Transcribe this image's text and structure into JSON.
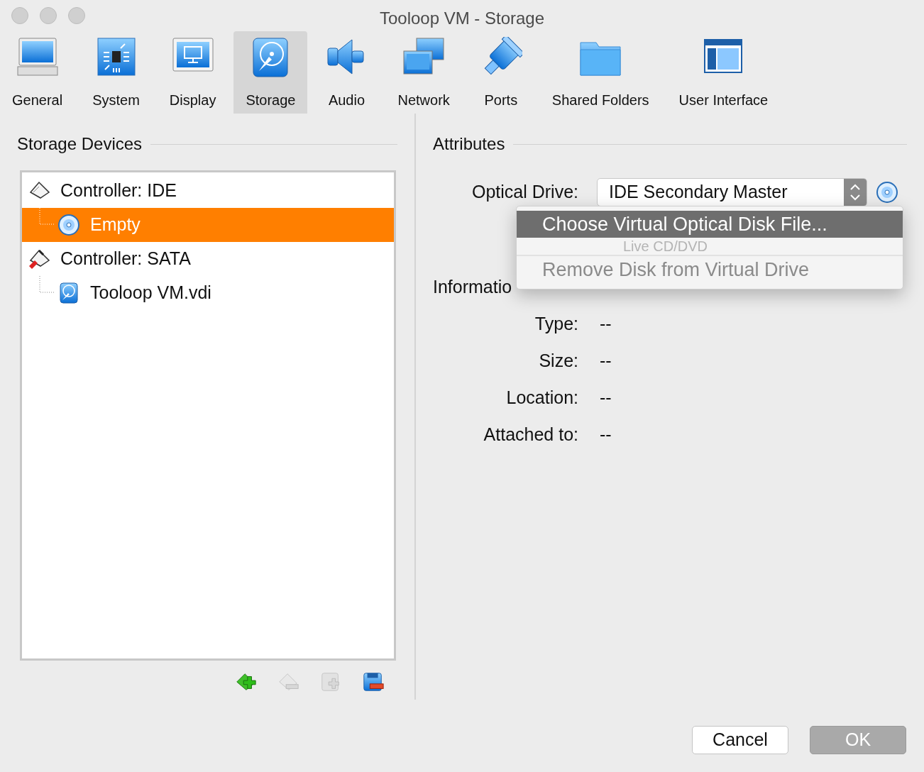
{
  "window": {
    "title": "Tooloop VM - Storage"
  },
  "toolbar": [
    {
      "label": "General",
      "kind": "monitor",
      "selected": false
    },
    {
      "label": "System",
      "kind": "chip",
      "selected": false
    },
    {
      "label": "Display",
      "kind": "display",
      "selected": false
    },
    {
      "label": "Storage",
      "kind": "disk",
      "selected": true
    },
    {
      "label": "Audio",
      "kind": "speaker",
      "selected": false
    },
    {
      "label": "Network",
      "kind": "network",
      "selected": false
    },
    {
      "label": "Ports",
      "kind": "plug",
      "selected": false
    },
    {
      "label": "Shared Folders",
      "kind": "folder",
      "selected": false
    },
    {
      "label": "User Interface",
      "kind": "window",
      "selected": false
    }
  ],
  "storage_devices": {
    "title": "Storage Devices",
    "tree": [
      {
        "label": "Controller: IDE",
        "kind": "ide",
        "selected": false,
        "children": [
          {
            "label": "Empty",
            "kind": "optical",
            "selected": true
          }
        ]
      },
      {
        "label": "Controller: SATA",
        "kind": "sata",
        "selected": false,
        "children": [
          {
            "label": "Tooloop VM.vdi",
            "kind": "harddisk",
            "selected": false
          }
        ]
      }
    ],
    "buttons": [
      {
        "kind": "add-controller",
        "disabled": false
      },
      {
        "kind": "remove-controller",
        "disabled": true
      },
      {
        "kind": "add-attachment",
        "disabled": true
      },
      {
        "kind": "remove-attachment",
        "disabled": false
      }
    ]
  },
  "attributes": {
    "title": "Attributes",
    "optical_drive": {
      "label": "Optical Drive:",
      "value": "IDE Secondary Master"
    },
    "menu": [
      {
        "label": "Choose Virtual Optical Disk File...",
        "kind": "item",
        "selected": true,
        "disabled": false
      },
      {
        "label": "Live CD/DVD",
        "kind": "ghost",
        "selected": false,
        "disabled": true
      },
      {
        "label": "Remove Disk from Virtual Drive",
        "kind": "item",
        "selected": false,
        "disabled": true
      }
    ]
  },
  "information": {
    "title": "Informatio",
    "rows": [
      {
        "label": "Type:",
        "value": "--"
      },
      {
        "label": "Size:",
        "value": "--"
      },
      {
        "label": "Location:",
        "value": "--"
      },
      {
        "label": "Attached to:",
        "value": "--"
      }
    ]
  },
  "buttons": [
    {
      "label": "Cancel",
      "default": false
    },
    {
      "label": "OK",
      "default": true
    }
  ]
}
